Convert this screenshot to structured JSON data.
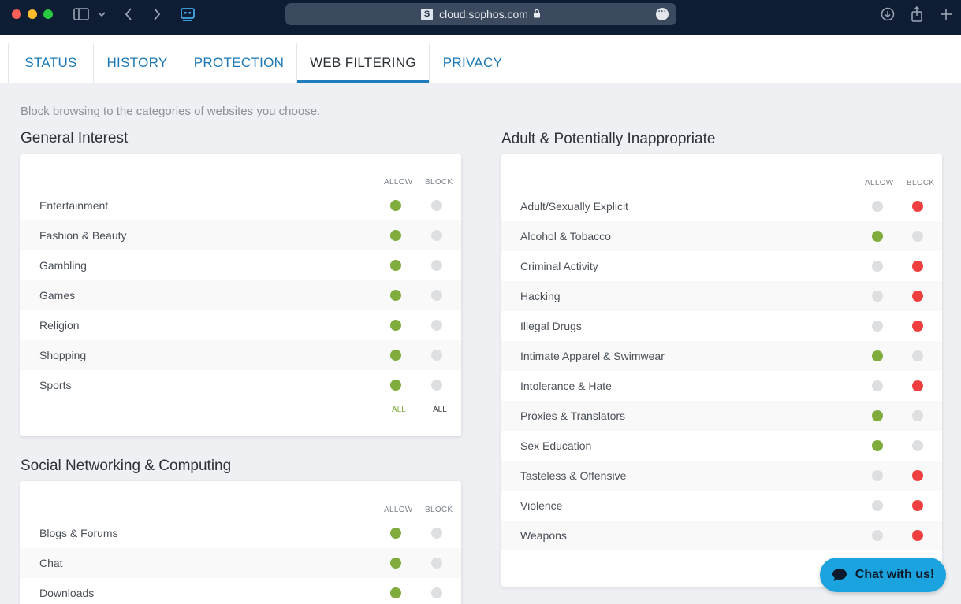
{
  "browser": {
    "url": "cloud.sophos.com",
    "site_icon_letter": "S"
  },
  "tabs": [
    {
      "label": "STATUS",
      "active": false
    },
    {
      "label": "HISTORY",
      "active": false
    },
    {
      "label": "PROTECTION",
      "active": false
    },
    {
      "label": "WEB FILTERING",
      "active": true
    },
    {
      "label": "PRIVACY",
      "active": false
    }
  ],
  "intro": "Block browsing to the categories of websites you choose.",
  "columns": {
    "allow": "ALLOW",
    "block": "BLOCK",
    "all": "ALL"
  },
  "general": {
    "title": "General Interest",
    "items": [
      {
        "label": "Entertainment",
        "blocked": false
      },
      {
        "label": "Fashion & Beauty",
        "blocked": false
      },
      {
        "label": "Gambling",
        "blocked": false
      },
      {
        "label": "Games",
        "blocked": false
      },
      {
        "label": "Religion",
        "blocked": false
      },
      {
        "label": "Shopping",
        "blocked": false
      },
      {
        "label": "Sports",
        "blocked": false
      }
    ]
  },
  "social": {
    "title": "Social Networking & Computing",
    "items": [
      {
        "label": "Blogs & Forums",
        "blocked": false
      },
      {
        "label": "Chat",
        "blocked": false
      },
      {
        "label": "Downloads",
        "blocked": false
      }
    ]
  },
  "adult": {
    "title": "Adult & Potentially Inappropriate",
    "items": [
      {
        "label": "Adult/Sexually Explicit",
        "blocked": true
      },
      {
        "label": "Alcohol & Tobacco",
        "blocked": false
      },
      {
        "label": "Criminal Activity",
        "blocked": true
      },
      {
        "label": "Hacking",
        "blocked": true
      },
      {
        "label": "Illegal Drugs",
        "blocked": true
      },
      {
        "label": "Intimate Apparel & Swimwear",
        "blocked": false
      },
      {
        "label": "Intolerance & Hate",
        "blocked": true
      },
      {
        "label": "Proxies & Translators",
        "blocked": false
      },
      {
        "label": "Sex Education",
        "blocked": false
      },
      {
        "label": "Tasteless & Offensive",
        "blocked": true
      },
      {
        "label": "Violence",
        "blocked": true
      },
      {
        "label": "Weapons",
        "blocked": true
      }
    ]
  },
  "chat_label": "Chat with us!",
  "colors": {
    "allow": "#7fac3c",
    "block": "#ef3f3f",
    "off": "#dedfe1",
    "accent": "#1f7dbd"
  }
}
